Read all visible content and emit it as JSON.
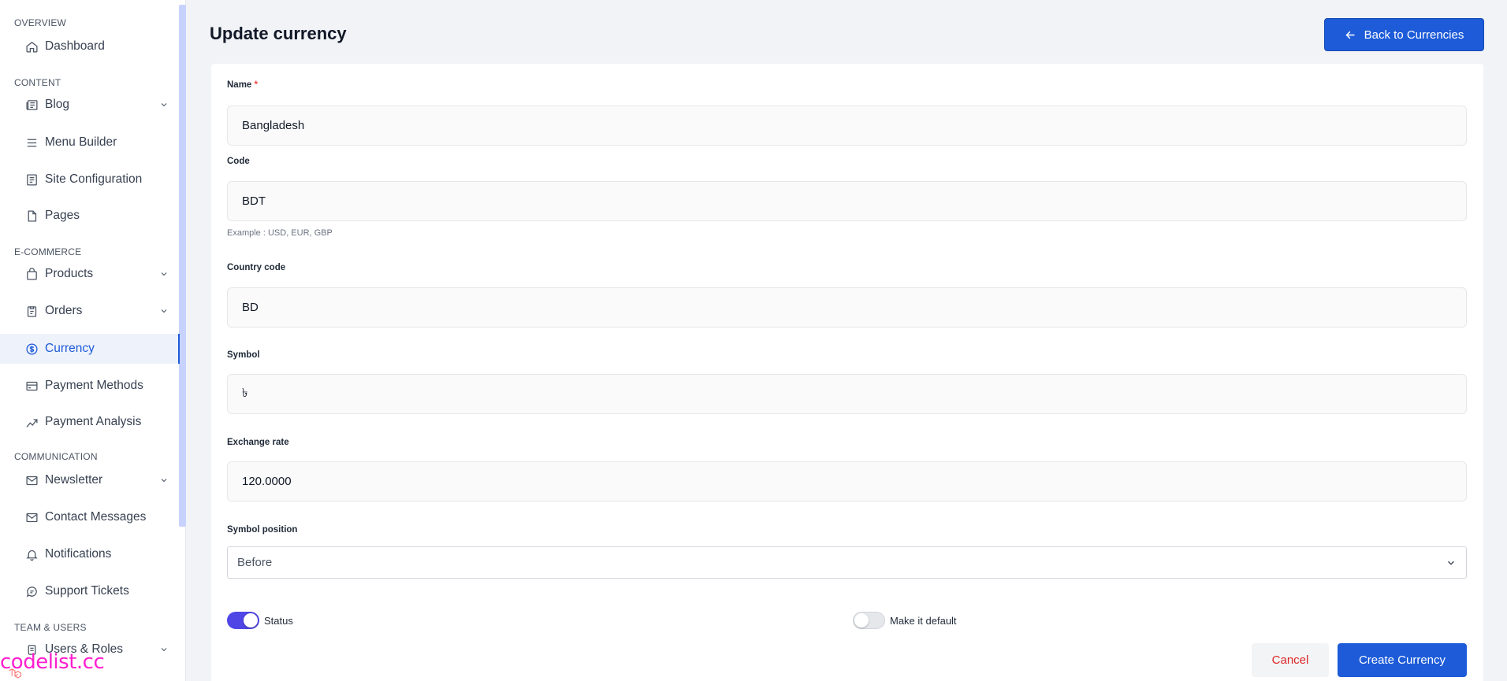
{
  "sidebar": {
    "sections": {
      "overview": "OVERVIEW",
      "content": "CONTENT",
      "ecommerce": "E-COMMERCE",
      "communication": "COMMUNICATION",
      "team": "TEAM & USERS"
    },
    "items": {
      "dashboard": "Dashboard",
      "blog": "Blog",
      "menu_builder": "Menu Builder",
      "site_configuration": "Site Configuration",
      "pages": "Pages",
      "products": "Products",
      "orders": "Orders",
      "currency": "Currency",
      "payment_methods": "Payment Methods",
      "payment_analysis": "Payment Analysis",
      "newsletter": "Newsletter",
      "contact_messages": "Contact Messages",
      "notifications": "Notifications",
      "support_tickets": "Support Tickets",
      "users_roles": "Users & Roles"
    },
    "active_item": "currency"
  },
  "header": {
    "title": "Update currency",
    "back_button": "Back to Currencies"
  },
  "form": {
    "name": {
      "label": "Name",
      "required": "*",
      "value": "Bangladesh"
    },
    "code": {
      "label": "Code",
      "value": "BDT",
      "help": "Example : USD, EUR, GBP"
    },
    "country_code": {
      "label": "Country code",
      "value": "BD"
    },
    "symbol": {
      "label": "Symbol",
      "value": "৳"
    },
    "exchange_rate": {
      "label": "Exchange rate",
      "value": "120.0000"
    },
    "symbol_position": {
      "label": "Symbol position",
      "selected": "Before"
    },
    "status": {
      "label": "Status",
      "on": true
    },
    "make_default": {
      "label": "Make it default",
      "on": false
    },
    "cancel": "Cancel",
    "submit": "Create Currency"
  },
  "watermark": "codelist.cc",
  "colors": {
    "primary": "#1d5bd8",
    "toggle_on": "#4f46e5",
    "cancel_text": "#dc2626",
    "required": "#ef4444",
    "watermark": "#ff1fcf"
  }
}
